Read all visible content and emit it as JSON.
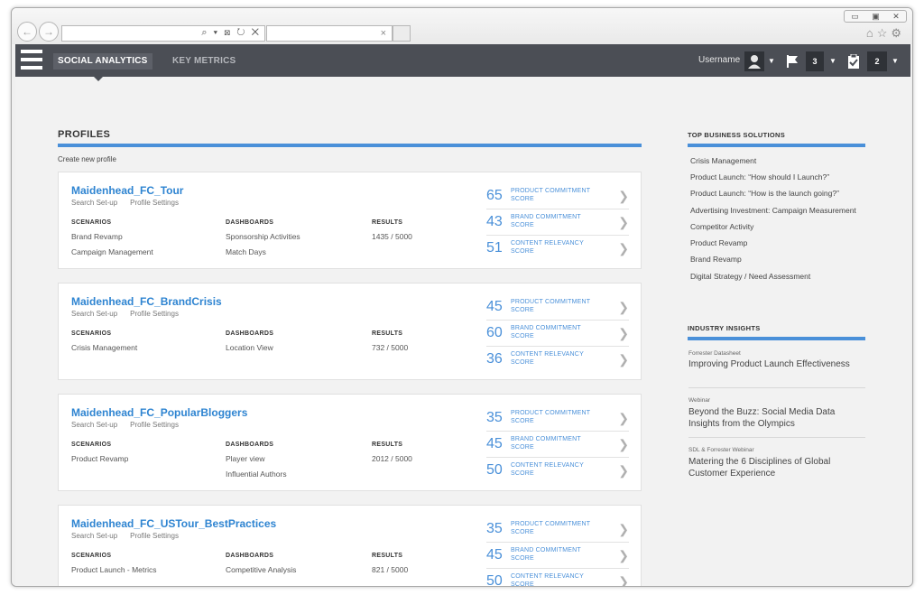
{
  "browser": {
    "address_icons": "⌕ ▾ ⊠ ↻ ✕",
    "tab_close": "×",
    "window_controls": [
      "▭",
      "▣",
      "✕"
    ],
    "tool_icons": [
      "home-icon",
      "star-icon",
      "gear-icon"
    ]
  },
  "header": {
    "tabs": [
      {
        "label": "SOCIAL ANALYTICS",
        "active": true
      },
      {
        "label": "KEY METRICS",
        "active": false
      }
    ],
    "username": "Username",
    "flag_count": "3",
    "task_count": "2"
  },
  "profiles": {
    "title": "PROFILES",
    "create_link": "Create new profile",
    "link_setup": "Search Set-up",
    "link_settings": "Profile Settings",
    "col_scenarios": "SCENARIOS",
    "col_dashboards": "DASHBOARDS",
    "col_results": "RESULTS",
    "score_labels": {
      "product": [
        "PRODUCT COMMITMENT",
        "SCORE"
      ],
      "brand": [
        "BRAND COMMITMENT",
        "SCORE"
      ],
      "content": [
        "CONTENT RELEVANCY",
        "SCORE"
      ]
    },
    "items": [
      {
        "name": "Maidenhead_FC_Tour",
        "scenarios": [
          "Brand Revamp",
          "Campaign Management"
        ],
        "dashboards": [
          "Sponsorship Activities",
          "Match Days"
        ],
        "results": "1435 / 5000",
        "scores": [
          "65",
          "43",
          "51"
        ]
      },
      {
        "name": "Maidenhead_FC_BrandCrisis",
        "scenarios": [
          "Crisis Management"
        ],
        "dashboards": [
          "Location View"
        ],
        "results": "732 / 5000",
        "scores": [
          "45",
          "60",
          "36"
        ]
      },
      {
        "name": "Maidenhead_FC_PopularBloggers",
        "scenarios": [
          "Product Revamp"
        ],
        "dashboards": [
          "Player view",
          "Influential Authors"
        ],
        "results": "2012 / 5000",
        "scores": [
          "35",
          "45",
          "50"
        ]
      },
      {
        "name": "Maidenhead_FC_USTour_BestPractices",
        "scenarios": [
          "Product Launch - Metrics"
        ],
        "dashboards": [
          "Competitive Analysis"
        ],
        "results": "821 / 5000",
        "scores": [
          "35",
          "45",
          "50"
        ]
      }
    ]
  },
  "sidebar": {
    "business_title": "TOP BUSINESS SOLUTIONS",
    "business_items": [
      "Crisis Management",
      "Product Launch: “How should I Launch?”",
      "Product Launch: “How is the launch going?”",
      "Advertising Investment: Campaign Measurement",
      "Competitor Activity",
      "Product Revamp",
      "Brand Revamp",
      "Digital Strategy / Need Assessment"
    ],
    "insights_title": "INDUSTRY INSIGHTS",
    "insights": [
      {
        "type": "Forrester Datasheet",
        "title": "Improving Product Launch Effectiveness"
      },
      {
        "type": "Webinar",
        "title": "Beyond the Buzz: Social Media Data Insights from the Olympics"
      },
      {
        "type": "SDL & Forrester Webinar",
        "title": "Matering the 6 Disciplines of Global Customer Experience"
      }
    ]
  },
  "colors": {
    "accent": "#4a90d9",
    "appbar": "#4b4e55",
    "title_link": "#2e84d1"
  }
}
